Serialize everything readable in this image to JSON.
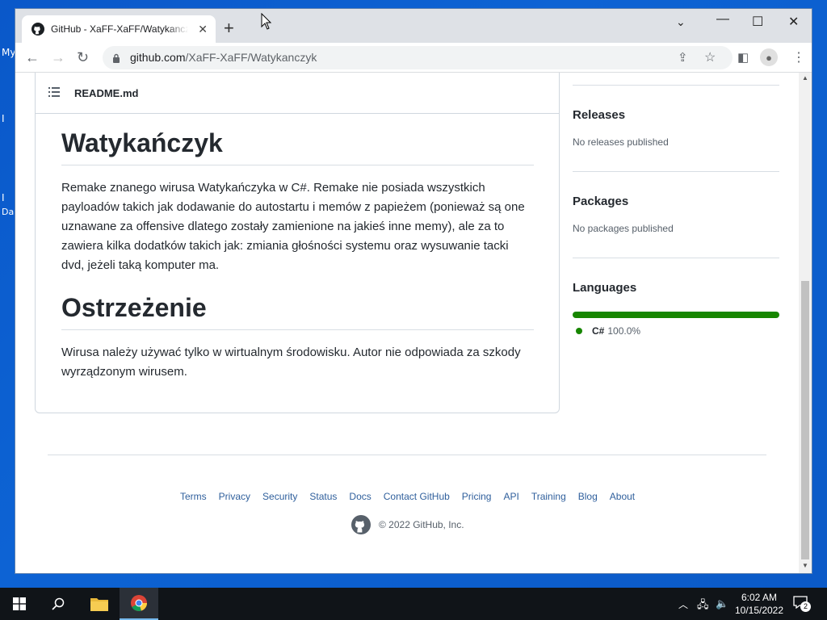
{
  "desktop": {
    "labels": [
      "My",
      "I",
      "I",
      "Da"
    ]
  },
  "browser": {
    "tab_title": "GitHub - XaFF-XaFF/Watykanczyk",
    "url_host": "github.com",
    "url_path": "/XaFF-XaFF/Watykanczyk"
  },
  "readme": {
    "file_label": "README.md",
    "h1": "Watykańczyk",
    "p1": "Remake znanego wirusa Watykańczyka w C#. Remake nie posiada wszystkich payloadów takich jak dodawanie do autostartu i memów z papieżem (ponieważ są one uznawane za offensive dlatego zostały zamienione na jakieś inne memy), ale za to zawiera kilka dodatków takich jak: zmiania głośności systemu oraz wysuwanie tacki dvd, jeżeli taką komputer ma.",
    "h2": "Ostrzeżenie",
    "p2": "Wirusa należy używać tylko w wirtualnym środowisku. Autor nie odpowiada za szkody wyrządzonym wirusem."
  },
  "sidebar": {
    "releases_title": "Releases",
    "releases_text": "No releases published",
    "packages_title": "Packages",
    "packages_text": "No packages published",
    "languages_title": "Languages",
    "language_name": "C#",
    "language_pct": "100.0%",
    "language_fraction": 1.0,
    "language_color": "#178600"
  },
  "footer": {
    "links": [
      "Terms",
      "Privacy",
      "Security",
      "Status",
      "Docs",
      "Contact GitHub",
      "Pricing",
      "API",
      "Training",
      "Blog",
      "About"
    ],
    "copyright": "© 2022 GitHub, Inc."
  },
  "taskbar": {
    "time": "6:02 AM",
    "date": "10/15/2022",
    "notifications": "2"
  }
}
